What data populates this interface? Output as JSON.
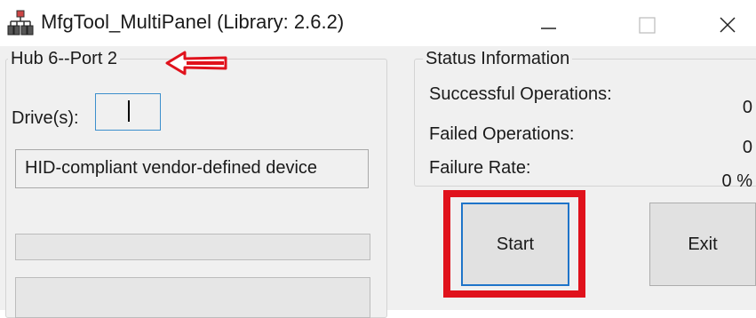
{
  "window": {
    "title": "MfgTool_MultiPanel (Library: 2.6.2)",
    "icon": "network-hub-icon",
    "controls": [
      "minimize",
      "maximize",
      "close"
    ]
  },
  "port_panel": {
    "title": "Hub 6--Port 2",
    "drive_label": "Drive(s):",
    "drive_value": "",
    "device_name": "HID-compliant vendor-defined device",
    "progress": [
      0,
      0
    ]
  },
  "status_panel": {
    "title": "Status Information",
    "successful_label": "Successful Operations:",
    "successful_value": "0",
    "failed_label": "Failed Operations:",
    "failed_value": "0",
    "rate_label": "Failure Rate:",
    "rate_value": "0 %"
  },
  "buttons": {
    "start_label": "Start",
    "exit_label": "Exit"
  },
  "colors": {
    "annotation_red": "#e0121c",
    "focus_blue": "#1e74c9",
    "panel_bg": "#f0f0f0"
  }
}
